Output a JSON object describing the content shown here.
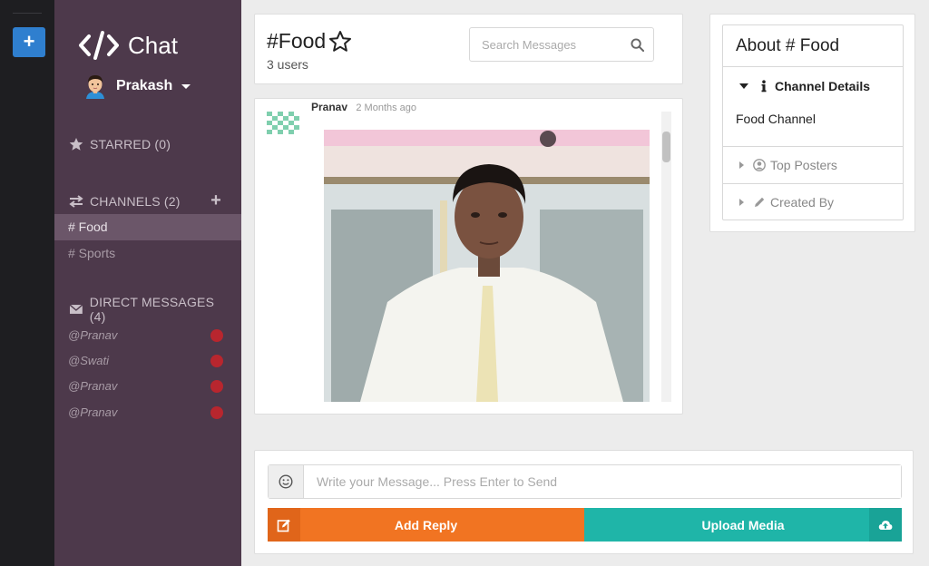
{
  "app": {
    "name": "Chat"
  },
  "user": {
    "name": "Prakash"
  },
  "sidebar": {
    "starred": {
      "label": "STARRED (0)"
    },
    "channels": {
      "label": "CHANNELS (2)",
      "items": [
        {
          "label": "# Food",
          "active": true
        },
        {
          "label": "# Sports",
          "active": false
        }
      ]
    },
    "direct_messages": {
      "label": "DIRECT MESSAGES (4)",
      "items": [
        {
          "label": "@Pranav",
          "unread": true
        },
        {
          "label": "@Swati",
          "unread": true
        },
        {
          "label": "@Pranav",
          "unread": true
        },
        {
          "label": "@Pranav",
          "unread": true
        }
      ]
    }
  },
  "channel": {
    "title": "#Food",
    "users": "3 users"
  },
  "search": {
    "placeholder": "Search Messages"
  },
  "message": {
    "author": "Pranav",
    "time": "2 Months ago"
  },
  "about": {
    "title": "About # Food",
    "details_label": "Channel Details",
    "details_body": "Food Channel",
    "top_posters_label": "Top Posters",
    "created_by_label": "Created By"
  },
  "composer": {
    "placeholder": "Write your Message... Press Enter to Send",
    "reply_label": "Add Reply",
    "upload_label": "Upload Media"
  },
  "colors": {
    "sidebar": "#4d394b",
    "rail": "#1e1e21",
    "accent_blue": "#2f7fcf",
    "reply_orange": "#f17422",
    "upload_teal": "#1fb5a8",
    "unread_dot": "#b8262e"
  },
  "icons": [
    "plus-icon",
    "code-icon",
    "star-icon",
    "exchange-icon",
    "envelope-icon",
    "search-icon",
    "info-icon",
    "user-circle-icon",
    "pencil-icon",
    "smile-icon",
    "edit-icon",
    "cloud-upload-icon"
  ]
}
